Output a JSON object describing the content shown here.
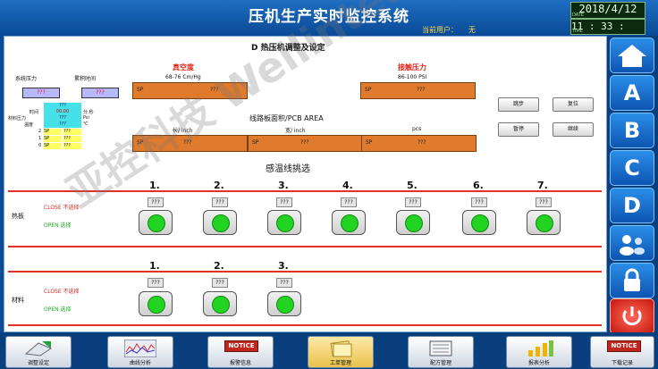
{
  "header": {
    "title": "压机生产实时监控系统",
    "user_label": "当前用户：",
    "user_value": "无",
    "date": "2018/4/12",
    "date_tag": "DATE",
    "time": "11 : 33 : 51",
    "time_tag": "TIME"
  },
  "main": {
    "section_title": "D 热压机调整及设定",
    "system_pressure_label": "系统压力",
    "system_pressure_value": "???",
    "cumulative_time_label": "累积时间",
    "cumulative_time_value": "???",
    "vacuum_title": "真空度",
    "vacuum_unit": "68-76 Cm/Hg",
    "vacuum_sp": "SP",
    "vacuum_value": "???",
    "contact_title": "接触压力",
    "contact_unit": "86-100 PSI",
    "contact_sp": "SP",
    "contact_value": "???",
    "area_title": "线路板面积/PCB AREA",
    "area_long_label": "长/ inch",
    "area_wide_label": "宽/ inch",
    "area_pcs_label": "pcs",
    "area_long_sp": "SP",
    "area_long_value": "???",
    "area_wide_sp": "SP",
    "area_wide_value": "???",
    "area_pcs_sp": "SP",
    "area_pcs_value": "???",
    "mini_table": {
      "time_label": "时间",
      "material_pressure_label": "材料压力",
      "temperature_label": "温度",
      "time_unit": "分.秒",
      "pressure_unit": "Psi",
      "temp_unit": "℃",
      "cell": "???",
      "cell_sp": "SP",
      "cell_value": "00.00",
      "rows": [
        "2",
        "1",
        "0"
      ]
    },
    "buttons": {
      "step": "跳步",
      "reset": "复位",
      "pause": "暂停",
      "continue": "继续"
    },
    "sensor_title": "感温线挑选",
    "hot_plate_label": "热板",
    "material_label": "材料",
    "close_label": "CLOSE 不选择",
    "open_label": "OPEN 选择",
    "hot_plate_nums": [
      "1.",
      "2.",
      "3.",
      "4.",
      "5.",
      "6.",
      "7."
    ],
    "material_nums": [
      "1.",
      "2.",
      "3."
    ],
    "placeholder": "???"
  },
  "sidebar": {
    "items": [
      "home-icon",
      "A",
      "B",
      "C",
      "D",
      "users-icon",
      "lock-icon",
      "power-icon"
    ]
  },
  "footer": {
    "buttons": [
      {
        "label": "调整设定",
        "icon": "adjust-icon"
      },
      {
        "label": "曲线分析",
        "icon": "chart-icon"
      },
      {
        "label": "报警信息",
        "icon": "notice-icon",
        "badge": "NOTICE"
      },
      {
        "label": "工单管理",
        "icon": "workorder-icon"
      },
      {
        "label": "配方管理",
        "icon": "recipe-icon"
      },
      {
        "label": "报表分析",
        "icon": "report-icon"
      },
      {
        "label": "下载记录",
        "icon": "download-icon",
        "badge": "NOTICE"
      }
    ]
  },
  "watermark": "亚控科技 Wellintech",
  "colors": {
    "field_orange": "#e07a2c",
    "lamp_green": "#22d322",
    "alert_red": "#e0261b",
    "bg_blue": "#0b4c94"
  }
}
